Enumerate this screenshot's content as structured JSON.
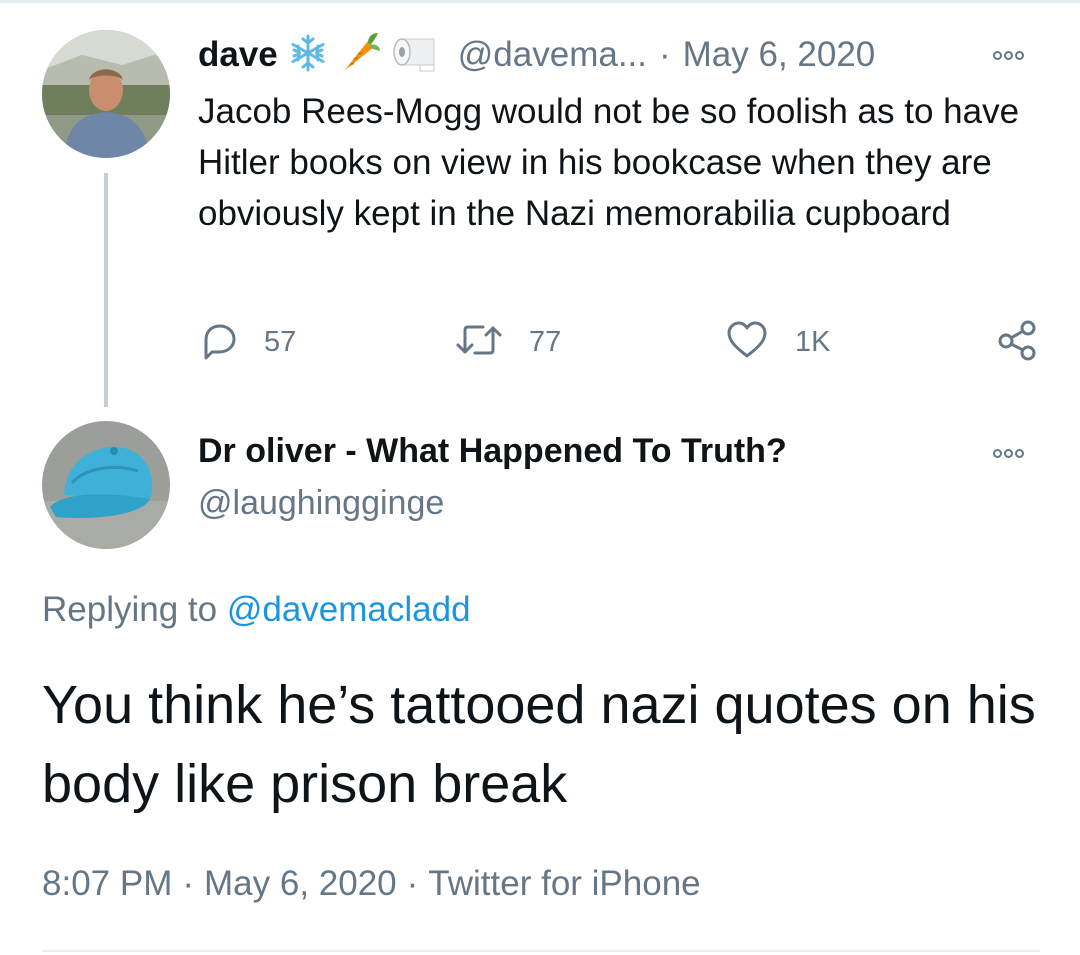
{
  "parent_tweet": {
    "author_name": "dave",
    "emojis": [
      "snowflake-emoji",
      "carrot-emoji",
      "toilet-paper-emoji"
    ],
    "handle": "@davema...",
    "separator": "·",
    "date": "May 6, 2020",
    "text": "Jacob Rees-Mogg would not be so foolish as to have Hitler books on view in his bookcase when they are obviously kept in the Nazi memorabilia cupboard",
    "replies_count": "57",
    "retweets_count": "77",
    "likes_count": "1K"
  },
  "reply_tweet": {
    "author_name": "Dr oliver - What Happened To Truth?",
    "handle": "@laughingginge",
    "replying_prefix": "Replying to",
    "replying_mention": "@davemacladd",
    "text": "You think he’s tattooed nazi quotes on his body like prison break",
    "time": "8:07 PM",
    "separator1": "·",
    "date": "May 6, 2020",
    "separator2": "·",
    "source": "Twitter for iPhone"
  },
  "colors": {
    "text_primary": "#0f1419",
    "text_secondary": "#657786",
    "link": "#1b95e0",
    "thread_line": "#c4cfd6"
  }
}
